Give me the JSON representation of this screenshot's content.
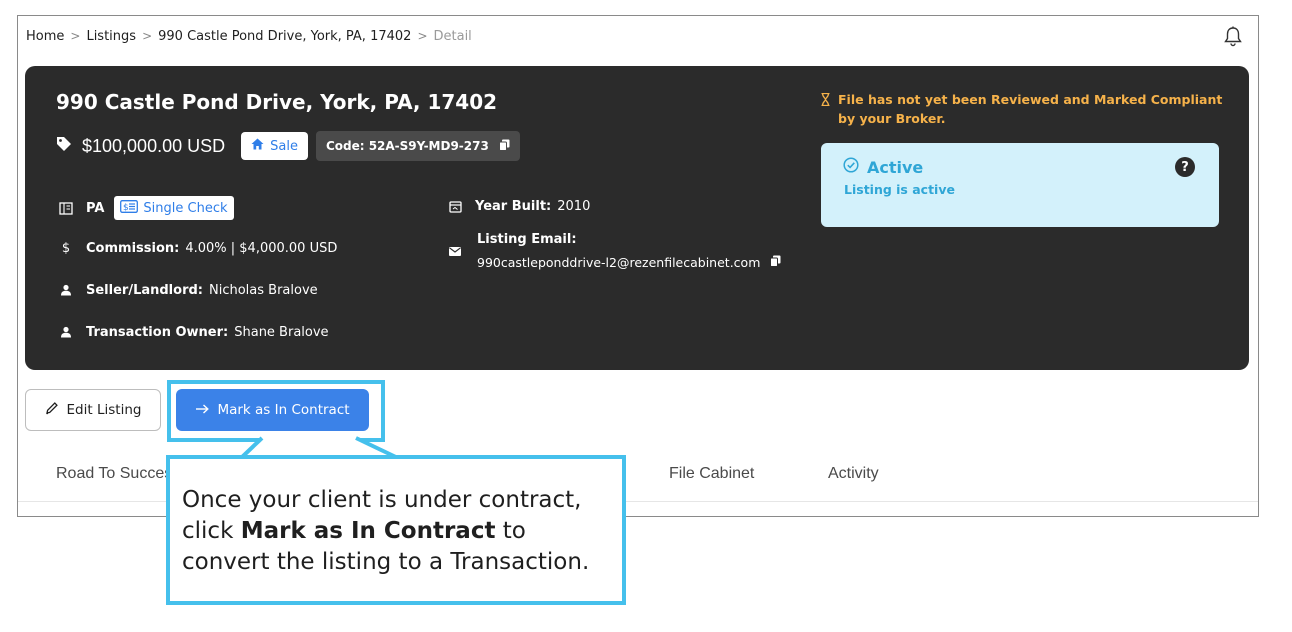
{
  "breadcrumb": {
    "home": "Home",
    "listings": "Listings",
    "address": "990 Castle Pond Drive, York, PA, 17402",
    "current": "Detail"
  },
  "listing": {
    "title": "990 Castle Pond Drive, York, PA, 17402",
    "price": "$100,000.00 USD",
    "sale_badge": "Sale",
    "code": "Code: 52A-S9Y-MD9-273",
    "state": "PA",
    "check_type": "Single Check",
    "commission_label": "Commission:",
    "commission_value": "4.00% | $4,000.00 USD",
    "seller_label": "Seller/Landlord:",
    "seller_value": "Nicholas Bralove",
    "owner_label": "Transaction Owner:",
    "owner_value": "Shane Bralove",
    "year_label": "Year Built:",
    "year_value": "2010",
    "email_label": "Listing Email:",
    "email_value": "990castleponddrive-l2@rezenfilecabinet.com"
  },
  "compliance": {
    "text": "File has not yet been Reviewed and Marked Compliant by your Broker.",
    "color": "#f6b24a"
  },
  "status": {
    "title": "Active",
    "subtitle": "Listing is active",
    "help": "?"
  },
  "actions": {
    "edit_label": "Edit Listing",
    "contract_label": "Mark as In Contract"
  },
  "tabs": [
    "Road To Success",
    "File Cabinet",
    "Activity"
  ],
  "callout": {
    "line1": "Once your client is under contract,",
    "line2_pre": "click ",
    "line2_bold": "Mark as In Contract",
    "line2_post": " to",
    "line3": "convert the listing to a Transaction."
  },
  "colors": {
    "card_bg": "#2b2b2b",
    "accent_blue": "#3b82e8",
    "highlight": "#45c0ec",
    "status_bg": "#d3f1fb"
  }
}
